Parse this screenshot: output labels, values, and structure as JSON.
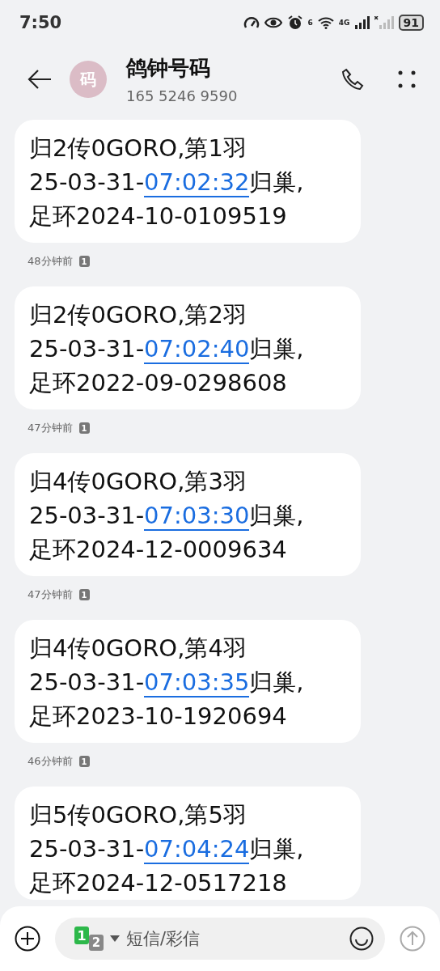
{
  "status_bar": {
    "time": "7:50",
    "wifi_label": "6",
    "network": "4G",
    "battery": "91"
  },
  "header": {
    "avatar": "码",
    "title": "鸽钟号码",
    "subtitle": "165 5246 9590"
  },
  "messages": [
    {
      "line1": "归2传0GORO,第1羽",
      "date": "25-03-31-",
      "link": "07:02:32",
      "after": "归巢,",
      "line3": "足环2024-10-0109519",
      "time_ago": "48分钟前",
      "sim": "1"
    },
    {
      "line1": "归2传0GORO,第2羽",
      "date": "25-03-31-",
      "link": "07:02:40",
      "after": "归巢,",
      "line3": "足环2022-09-0298608",
      "time_ago": "47分钟前",
      "sim": "1"
    },
    {
      "line1": "归4传0GORO,第3羽",
      "date": "25-03-31-",
      "link": "07:03:30",
      "after": "归巢,",
      "line3": "足环2024-12-0009634",
      "time_ago": "47分钟前",
      "sim": "1"
    },
    {
      "line1": "归4传0GORO,第4羽",
      "date": "25-03-31-",
      "link": "07:03:35",
      "after": "归巢,",
      "line3": "足环2023-10-1920694",
      "time_ago": "46分钟前",
      "sim": "1"
    },
    {
      "line1": "归5传0GORO,第5羽",
      "date": "25-03-31-",
      "link": "07:04:24",
      "after": "归巢,",
      "line3": "足环2024-12-0517218"
    }
  ],
  "composer": {
    "sim_primary": "1",
    "sim_secondary": "2",
    "placeholder": "短信/彩信"
  }
}
